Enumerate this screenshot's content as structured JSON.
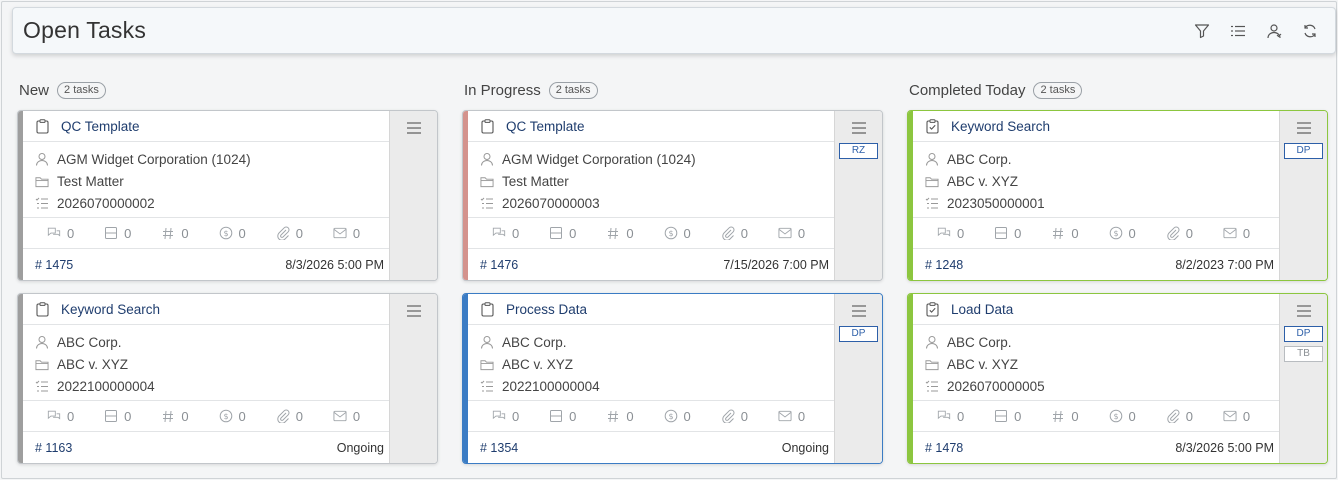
{
  "header": {
    "title": "Open Tasks",
    "tools": [
      "filter-icon",
      "list-icon",
      "user-icon",
      "refresh-icon"
    ]
  },
  "colors": {
    "gray": "#9e9e9e",
    "pink": "#d4938d",
    "blue": "#3b7cc4",
    "green": "#8cc63f"
  },
  "columns": [
    {
      "title": "New",
      "count": "2 tasks",
      "cards": [
        {
          "title": "QC Template",
          "icon": "clipboard-icon",
          "client": "AGM Widget Corporation (1024)",
          "matter": "Test Matter",
          "ref": "2026070000002",
          "stats": [
            "0",
            "0",
            "0",
            "0",
            "0",
            "0"
          ],
          "number": "# 1475",
          "due": "8/3/2026 5:00 PM",
          "chips": []
        },
        {
          "title": "Keyword Search",
          "icon": "clipboard-icon",
          "client": "ABC Corp.",
          "matter": "ABC v. XYZ",
          "ref": "2022100000004",
          "stats": [
            "0",
            "0",
            "0",
            "0",
            "0",
            "0"
          ],
          "number": "# 1163",
          "due": "Ongoing",
          "chips": []
        }
      ]
    },
    {
      "title": "In Progress",
      "count": "2 tasks",
      "cards": [
        {
          "title": "QC Template",
          "icon": "clipboard-icon",
          "client": "AGM Widget Corporation (1024)",
          "matter": "Test Matter",
          "ref": "2026070000003",
          "stats": [
            "0",
            "0",
            "0",
            "0",
            "0",
            "0"
          ],
          "number": "# 1476",
          "due": "7/15/2026 7:00 PM",
          "chips": [
            "RZ"
          ]
        },
        {
          "title": "Process Data",
          "icon": "clipboard-icon",
          "client": "ABC Corp.",
          "matter": "ABC v. XYZ",
          "ref": "2022100000004",
          "stats": [
            "0",
            "0",
            "0",
            "0",
            "0",
            "0"
          ],
          "number": "# 1354",
          "due": "Ongoing",
          "chips": [
            "DP"
          ]
        }
      ]
    },
    {
      "title": "Completed Today",
      "count": "2 tasks",
      "cards": [
        {
          "title": "Keyword Search",
          "icon": "clipboard-check-icon",
          "client": "ABC Corp.",
          "matter": "ABC v. XYZ",
          "ref": "2023050000001",
          "stats": [
            "0",
            "0",
            "0",
            "0",
            "0",
            "0"
          ],
          "number": "# 1248",
          "due": "8/2/2023 7:00 PM",
          "chips": [
            "DP"
          ]
        },
        {
          "title": "Load Data",
          "icon": "clipboard-check-icon",
          "client": "ABC Corp.",
          "matter": "ABC v. XYZ",
          "ref": "2026070000005",
          "stats": [
            "0",
            "0",
            "0",
            "0",
            "0",
            "0"
          ],
          "number": "# 1478",
          "due": "8/3/2026 5:00 PM",
          "chips": [
            "DP",
            "TB"
          ]
        }
      ]
    }
  ]
}
